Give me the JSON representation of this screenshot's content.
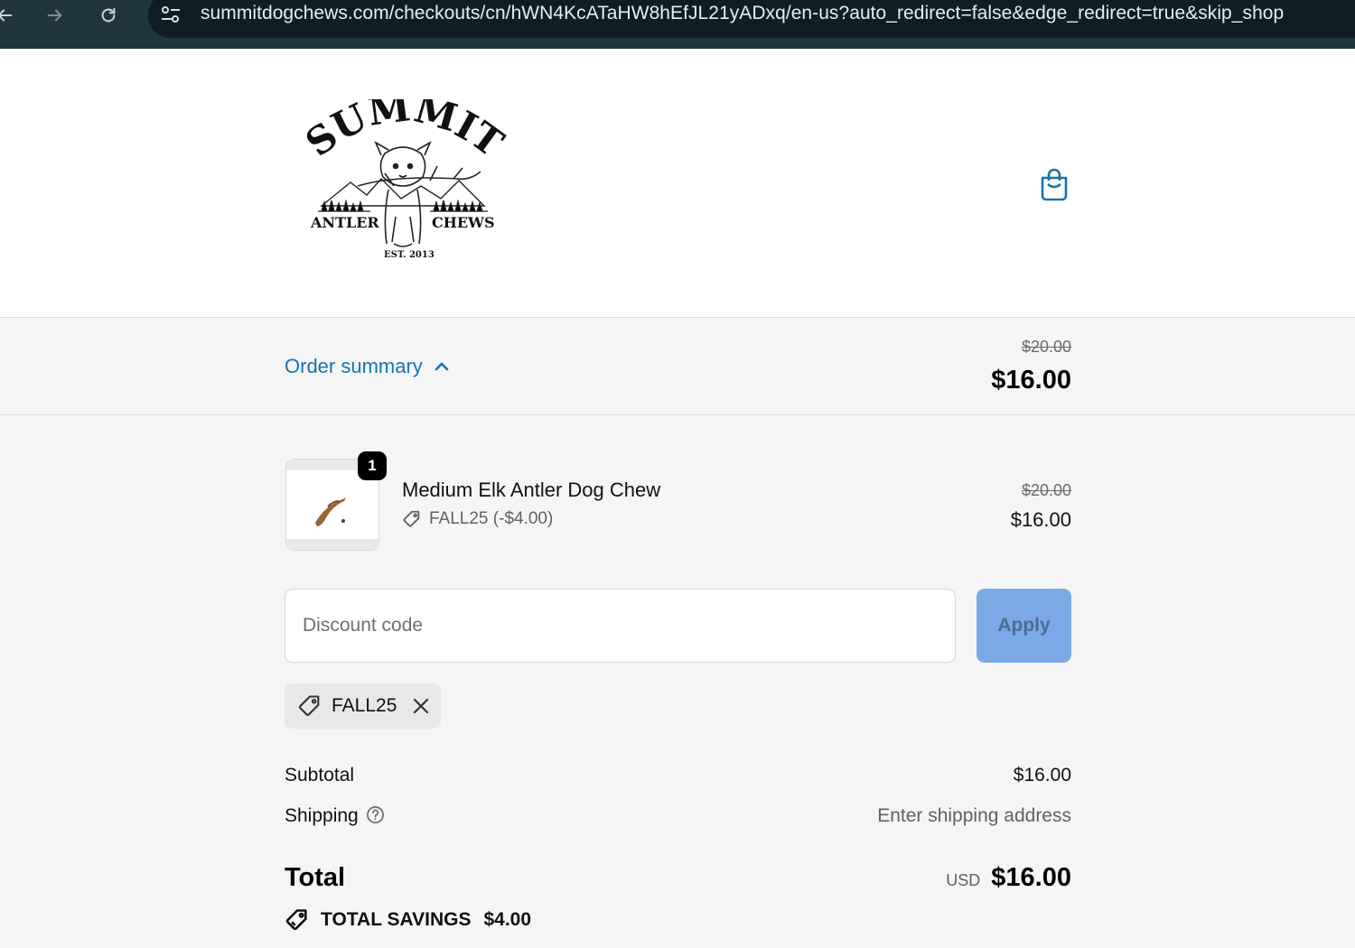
{
  "browser": {
    "url": "summitdogchews.com/checkouts/cn/hWN4KcATaHW8hEfJL21yADxq/en-us?auto_redirect=false&edge_redirect=true&skip_shop"
  },
  "brand": {
    "logo_top": "SUMMIT",
    "logo_left": "ANTLER",
    "logo_right": "CHEWS",
    "logo_bottom": "EST. 2013",
    "accent_color": "#1773b0"
  },
  "order_summary": {
    "toggle_label": "Order summary",
    "original_total": "$20.00",
    "total": "$16.00"
  },
  "line_item": {
    "quantity": "1",
    "name": "Medium Elk Antler Dog Chew",
    "discount": "FALL25 (-$4.00)",
    "original_price": "$20.00",
    "price": "$16.00"
  },
  "discount": {
    "placeholder": "Discount code",
    "apply_label": "Apply",
    "applied_code": "FALL25"
  },
  "totals": {
    "subtotal_label": "Subtotal",
    "subtotal_value": "$16.00",
    "shipping_label": "Shipping",
    "shipping_value": "Enter shipping address",
    "total_label": "Total",
    "currency": "USD",
    "total_value": "$16.00",
    "savings_label": "TOTAL SAVINGS",
    "savings_value": "$4.00"
  },
  "icons": {
    "back": "arrow-left-icon",
    "forward": "arrow-right-icon",
    "reload": "reload-icon",
    "site_info": "tune-icon",
    "cart": "shopping-bag-icon",
    "chevron": "chevron-up-icon",
    "tag": "tag-icon",
    "remove": "close-icon",
    "help": "question-circle-icon"
  }
}
